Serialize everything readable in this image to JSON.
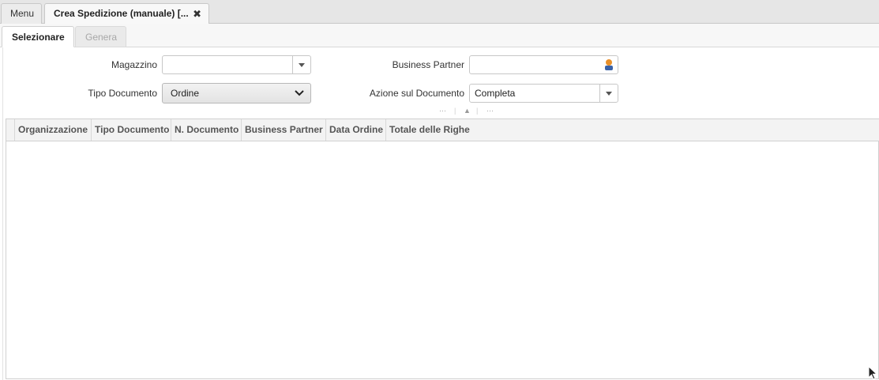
{
  "window_tabs": {
    "menu_label": "Menu",
    "active_label": "Crea Spedizione (manuale) [...",
    "close_glyph": "✖"
  },
  "inner_tabs": {
    "tab1": "Selezionare",
    "tab2": "Genera"
  },
  "form": {
    "magazzino_label": "Magazzino",
    "magazzino_value": "",
    "tipo_documento_label": "Tipo Documento",
    "tipo_documento_value": "Ordine",
    "business_partner_label": "Business Partner",
    "business_partner_value": "",
    "azione_label": "Azione sul Documento",
    "azione_value": "Completa"
  },
  "grid": {
    "columns": [
      "Organizzazione",
      "Tipo Documento",
      "N. Documento",
      "Business Partner",
      "Data Ordine",
      "Totale delle Righe"
    ],
    "rows": []
  },
  "colors": {
    "bp_icon_orange": "#e8902a",
    "bp_icon_blue": "#3a62a8"
  }
}
